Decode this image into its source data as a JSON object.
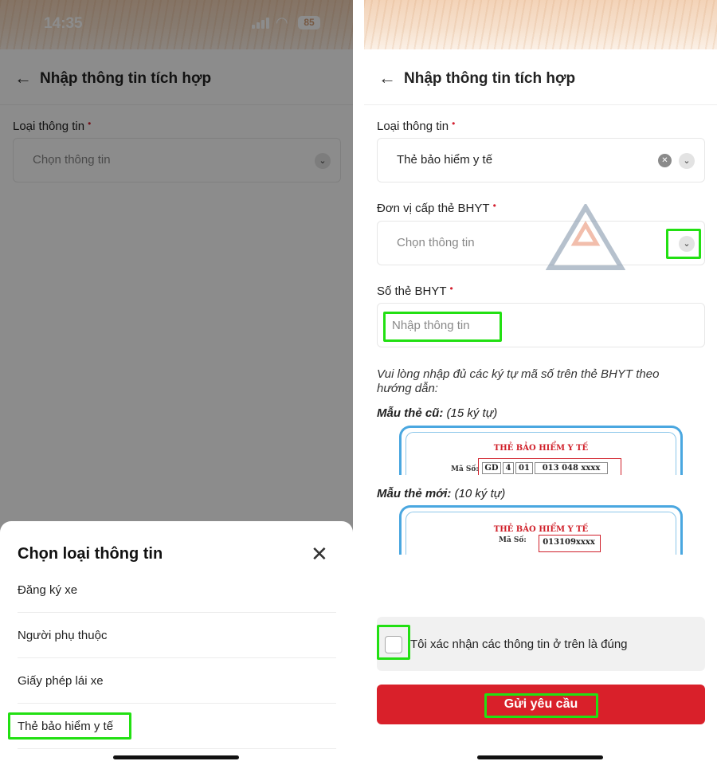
{
  "status": {
    "time": "14:35",
    "battery": "85"
  },
  "header": {
    "title": "Nhập thông tin tích hợp"
  },
  "left_screen": {
    "field_label": "Loại thông tin",
    "required_mark": "•",
    "select_placeholder": "Chọn thông tin"
  },
  "sheet": {
    "title": "Chọn loại thông tin",
    "items": [
      {
        "label": "Đăng ký xe"
      },
      {
        "label": "Người phụ thuộc"
      },
      {
        "label": "Giấy phép lái xe"
      },
      {
        "label": "Thẻ bảo hiểm y tế"
      }
    ]
  },
  "right_screen": {
    "type_field": {
      "label": "Loại thông tin",
      "value": "Thẻ bảo hiểm y tế"
    },
    "issuer_field": {
      "label": "Đơn vị cấp thẻ BHYT",
      "placeholder": "Chọn thông tin"
    },
    "card_number_field": {
      "label": "Số thẻ BHYT",
      "placeholder": "Nhập thông tin"
    },
    "required_mark": "•",
    "hint": "Vui lòng nhập đủ các ký tự mã số trên thẻ BHYT theo hướng dẫn:",
    "old_sample": {
      "label": "Mẫu thẻ cũ:",
      "note": "(15 ký tự)",
      "card_title": "THẺ BẢO HIỂM Y TẾ",
      "ma_so_label": "Mã Số:",
      "code_parts": [
        "GD",
        "4",
        "01",
        "013 048 xxxx"
      ]
    },
    "new_sample": {
      "label": "Mẫu thẻ mới:",
      "note": "(10 ký tự)",
      "card_title": "THẺ BẢO HIỂM Y TẾ",
      "ma_so_label": "Mã Số:",
      "code": "013109xxxx"
    },
    "confirm_text": "Tôi xác nhận các thông tin ở trên là đúng",
    "submit_label": "Gửi yêu cầu",
    "watermark": "Kế toán Anpha"
  },
  "colors": {
    "accent_red": "#d9202a",
    "highlight_green": "#22e012",
    "card_blue": "#4aa7e0"
  },
  "icons": [
    "back-arrow-icon",
    "chevron-down-icon",
    "clear-icon",
    "close-icon",
    "signal-icon",
    "wifi-icon",
    "battery-icon"
  ]
}
